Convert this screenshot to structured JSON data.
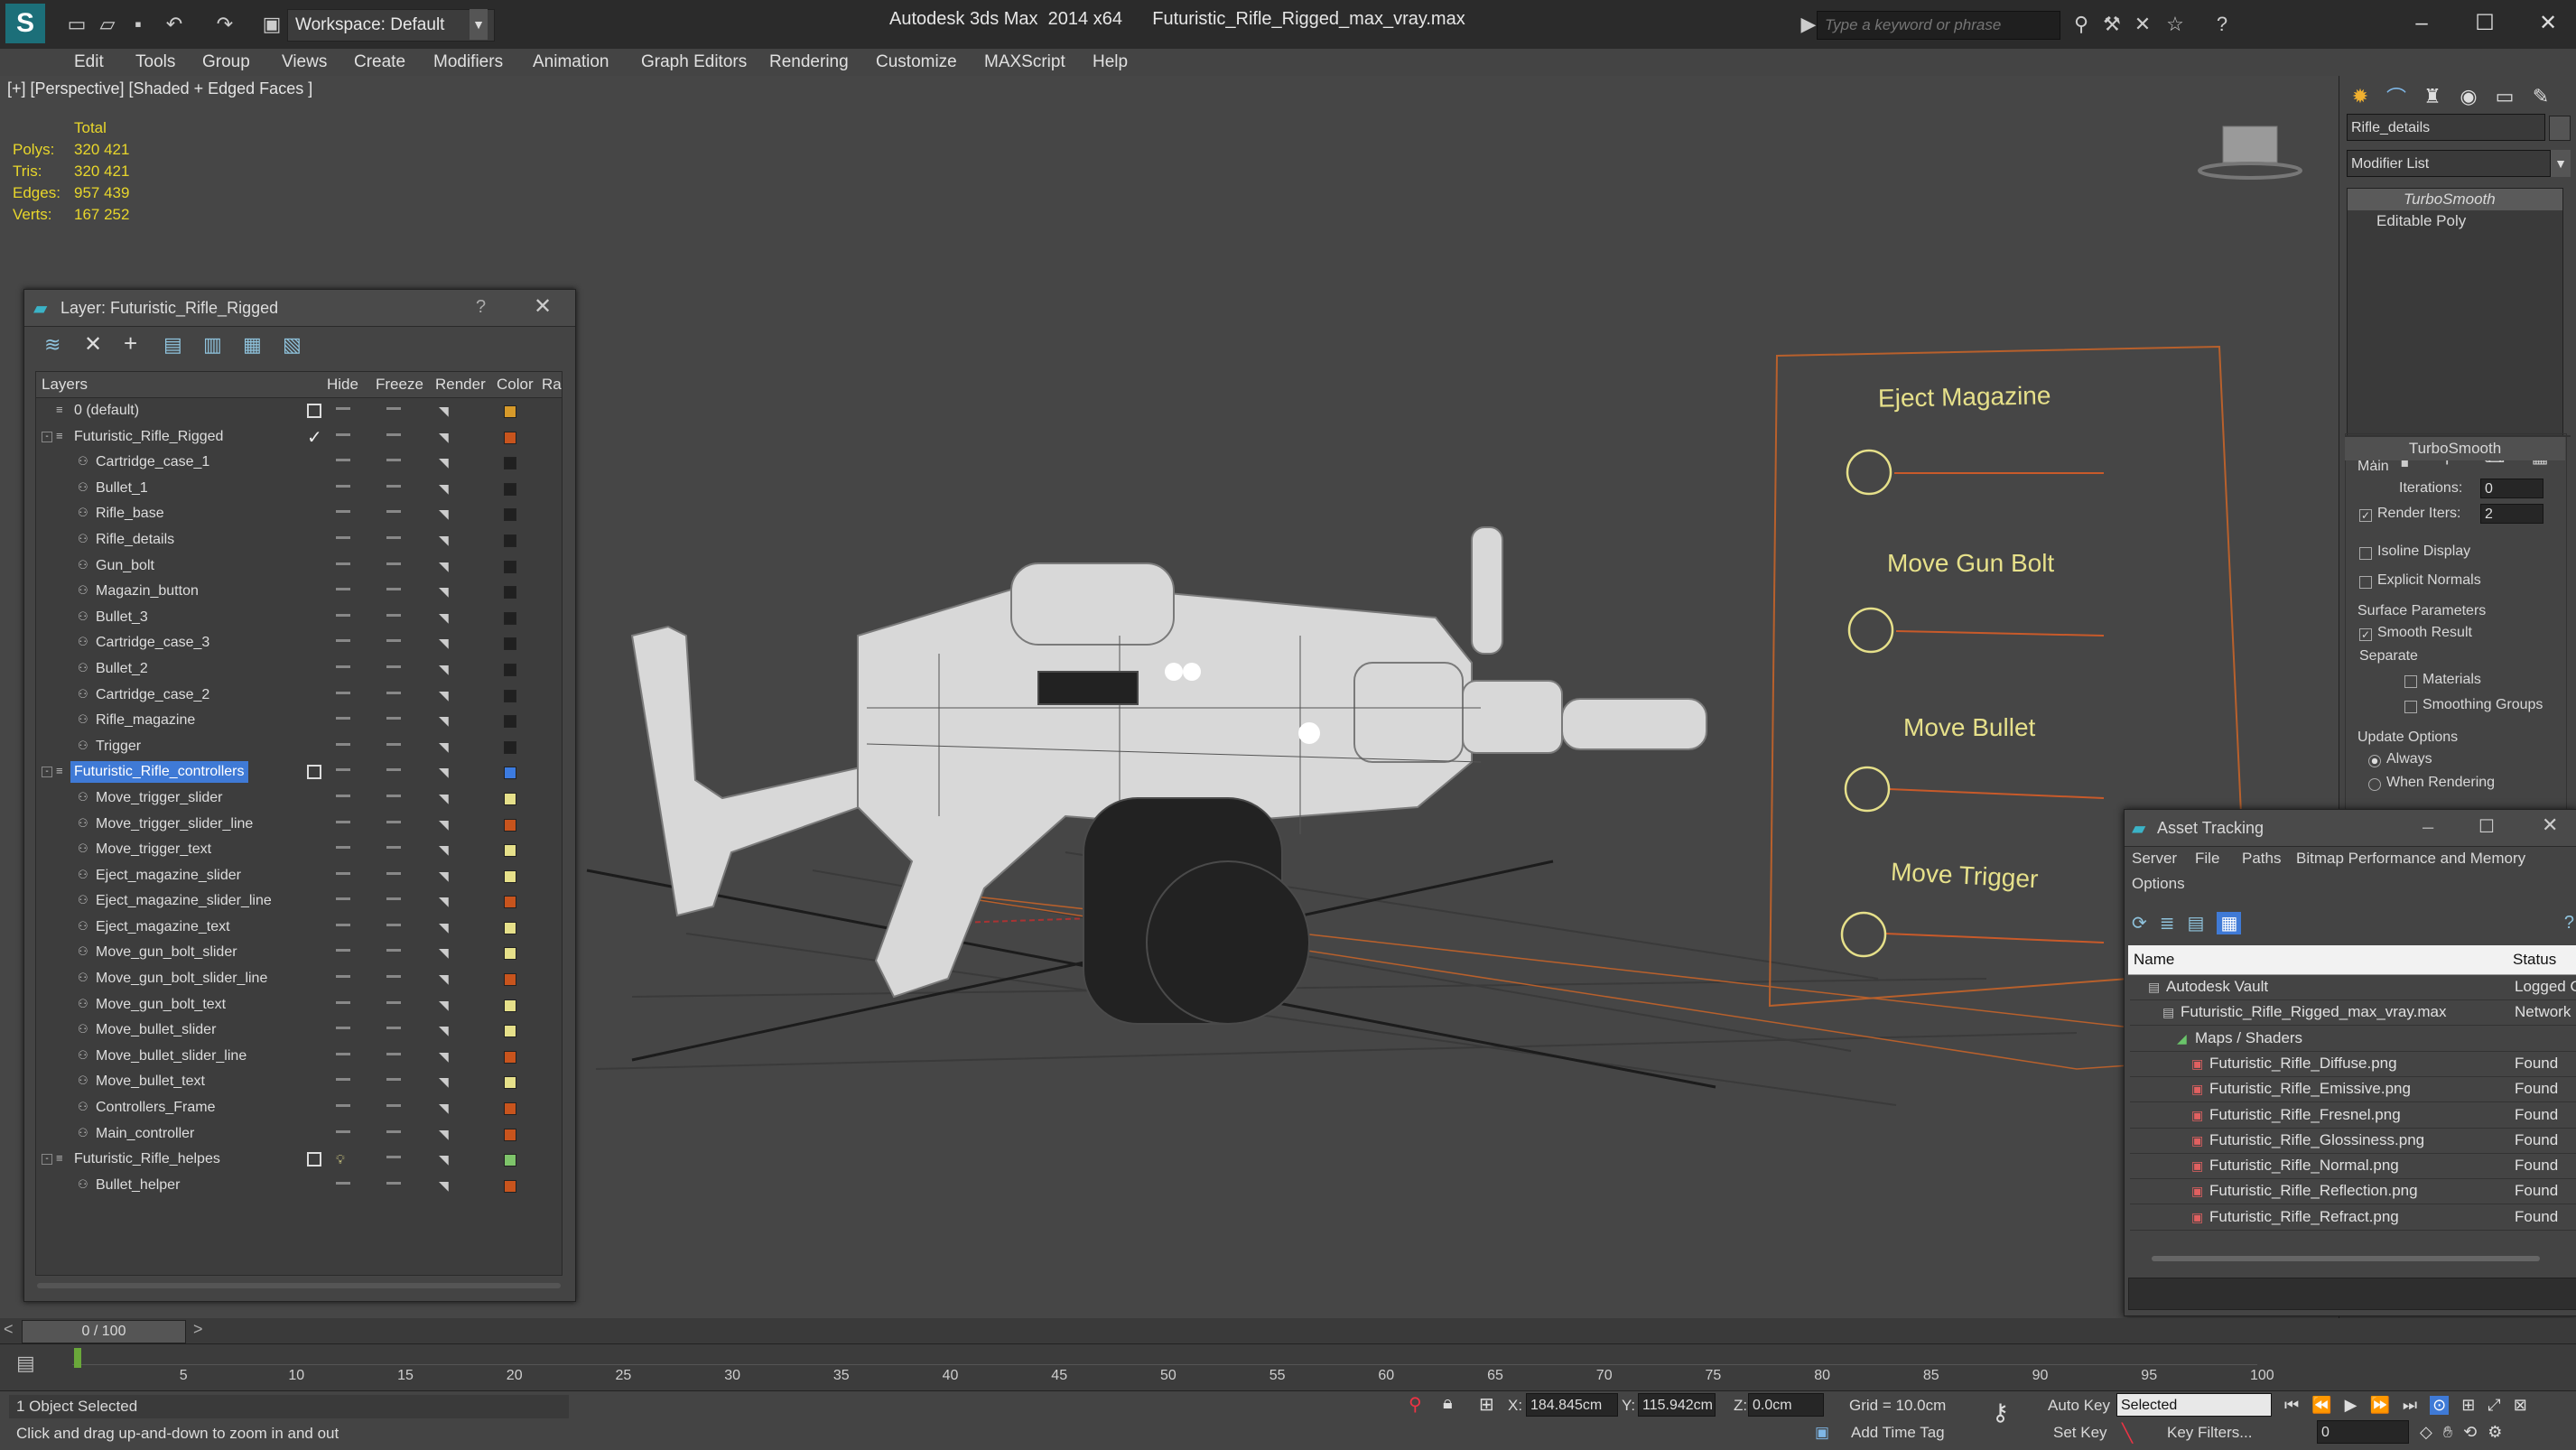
{
  "app": {
    "title": "Autodesk 3ds Max  2014 x64      Futuristic_Rifle_Rigged_max_vray.max",
    "workspace": "Workspace: Default",
    "search_placeholder": "Type a keyword or phrase"
  },
  "menu": [
    "Edit",
    "Tools",
    "Group",
    "Views",
    "Create",
    "Modifiers",
    "Animation",
    "Graph Editors",
    "Rendering",
    "Customize",
    "MAXScript",
    "Help"
  ],
  "viewport": {
    "label": "[+] [Perspective] [Shaded + Edged Faces ]",
    "stats_header": "Total",
    "stats": [
      {
        "label": "Polys:",
        "value": "320 421"
      },
      {
        "label": "Tris:",
        "value": "320 421"
      },
      {
        "label": "Edges:",
        "value": "957 439"
      },
      {
        "label": "Verts:",
        "value": "167 252"
      }
    ],
    "controls_board": [
      "Eject Magazine",
      "Move Gun Bolt",
      "Move Bullet",
      "Move Trigger"
    ]
  },
  "layer_dialog": {
    "title": "Layer: Futuristic_Rifle_Rigged",
    "help": "?",
    "columns": [
      "Layers",
      "Hide",
      "Freeze",
      "Render",
      "Color",
      "Ra"
    ],
    "rows": [
      {
        "name": "0 (default)",
        "level": 0,
        "kind": "layer",
        "color": "#d79a2a",
        "mark": "box"
      },
      {
        "name": "Futuristic_Rifle_Rigged",
        "level": 0,
        "kind": "layer",
        "expand": "-",
        "color": "#c8541d",
        "mark": "tick"
      },
      {
        "name": "Cartridge_case_1",
        "level": 1,
        "kind": "obj",
        "color": "#202020"
      },
      {
        "name": "Bullet_1",
        "level": 1,
        "kind": "obj",
        "color": "#202020"
      },
      {
        "name": "Rifle_base",
        "level": 1,
        "kind": "obj",
        "color": "#202020"
      },
      {
        "name": "Rifle_details",
        "level": 1,
        "kind": "obj",
        "color": "#202020"
      },
      {
        "name": "Gun_bolt",
        "level": 1,
        "kind": "obj",
        "color": "#202020"
      },
      {
        "name": "Magazin_button",
        "level": 1,
        "kind": "obj",
        "color": "#202020"
      },
      {
        "name": "Bullet_3",
        "level": 1,
        "kind": "obj",
        "color": "#202020"
      },
      {
        "name": "Cartridge_case_3",
        "level": 1,
        "kind": "obj",
        "color": "#202020"
      },
      {
        "name": "Bullet_2",
        "level": 1,
        "kind": "obj",
        "color": "#202020"
      },
      {
        "name": "Cartridge_case_2",
        "level": 1,
        "kind": "obj",
        "color": "#202020"
      },
      {
        "name": "Rifle_magazine",
        "level": 1,
        "kind": "obj",
        "color": "#202020"
      },
      {
        "name": "Trigger",
        "level": 1,
        "kind": "obj",
        "color": "#202020"
      },
      {
        "name": "Futuristic_Rifle_controllers",
        "level": 0,
        "kind": "layer",
        "expand": "-",
        "color": "#3c7be0",
        "mark": "box",
        "selected": true
      },
      {
        "name": "Move_trigger_slider",
        "level": 1,
        "kind": "obj",
        "color": "#e6e08a"
      },
      {
        "name": "Move_trigger_slider_line",
        "level": 1,
        "kind": "obj",
        "color": "#c8541d"
      },
      {
        "name": "Move_trigger_text",
        "level": 1,
        "kind": "obj",
        "color": "#e6e08a"
      },
      {
        "name": "Eject_magazine_slider",
        "level": 1,
        "kind": "obj",
        "color": "#e6e08a"
      },
      {
        "name": "Eject_magazine_slider_line",
        "level": 1,
        "kind": "obj",
        "color": "#c8541d"
      },
      {
        "name": "Eject_magazine_text",
        "level": 1,
        "kind": "obj",
        "color": "#e6e08a"
      },
      {
        "name": "Move_gun_bolt_slider",
        "level": 1,
        "kind": "obj",
        "color": "#e6e08a"
      },
      {
        "name": "Move_gun_bolt_slider_line",
        "level": 1,
        "kind": "obj",
        "color": "#c8541d"
      },
      {
        "name": "Move_gun_bolt_text",
        "level": 1,
        "kind": "obj",
        "color": "#e6e08a"
      },
      {
        "name": "Move_bullet_slider",
        "level": 1,
        "kind": "obj",
        "color": "#e6e08a"
      },
      {
        "name": "Move_bullet_slider_line",
        "level": 1,
        "kind": "obj",
        "color": "#c8541d"
      },
      {
        "name": "Move_bullet_text",
        "level": 1,
        "kind": "obj",
        "color": "#e6e08a"
      },
      {
        "name": "Controllers_Frame",
        "level": 1,
        "kind": "obj",
        "color": "#c8541d"
      },
      {
        "name": "Main_controller",
        "level": 1,
        "kind": "obj",
        "color": "#c8541d"
      },
      {
        "name": "Futuristic_Rifle_helpes",
        "level": 0,
        "kind": "layer",
        "expand": "-",
        "color": "#7ec46a",
        "mark": "box",
        "bulb": true
      },
      {
        "name": "Bullet_helper",
        "level": 1,
        "kind": "obj",
        "color": "#c8541d"
      }
    ]
  },
  "command_panel": {
    "object_name": "Rifle_details",
    "modifier_list": "Modifier List",
    "stack": [
      "TurboSmooth",
      "Editable Poly"
    ],
    "rollout_title": "TurboSmooth",
    "main_label": "Main",
    "iterations_label": "Iterations:",
    "iterations_value": "0",
    "render_iters_label": "Render Iters:",
    "render_iters_value": "2",
    "isoline": "Isoline Display",
    "explicit": "Explicit Normals",
    "surface_params": "Surface Parameters",
    "smooth_result": "Smooth Result",
    "separate": "Separate",
    "materials": "Materials",
    "smoothing_groups": "Smoothing Groups",
    "update_options": "Update Options",
    "always": "Always",
    "when_rendering": "When Rendering"
  },
  "asset_tracking": {
    "title": "Asset Tracking",
    "menu": [
      "Server",
      "File",
      "Paths",
      "Bitmap Performance and Memory",
      "Options"
    ],
    "col_name": "Name",
    "col_status": "Status",
    "rows": [
      {
        "name": "Autodesk Vault",
        "status": "Logged O",
        "indent": 1
      },
      {
        "name": "Futuristic_Rifle_Rigged_max_vray.max",
        "status": "Network",
        "indent": 2
      },
      {
        "name": "Maps / Shaders",
        "status": "",
        "indent": 3
      },
      {
        "name": "Futuristic_Rifle_Diffuse.png",
        "status": "Found",
        "indent": 4
      },
      {
        "name": "Futuristic_Rifle_Emissive.png",
        "status": "Found",
        "indent": 4
      },
      {
        "name": "Futuristic_Rifle_Fresnel.png",
        "status": "Found",
        "indent": 4
      },
      {
        "name": "Futuristic_Rifle_Glossiness.png",
        "status": "Found",
        "indent": 4
      },
      {
        "name": "Futuristic_Rifle_Normal.png",
        "status": "Found",
        "indent": 4
      },
      {
        "name": "Futuristic_Rifle_Reflection.png",
        "status": "Found",
        "indent": 4
      },
      {
        "name": "Futuristic_Rifle_Refract.png",
        "status": "Found",
        "indent": 4
      }
    ]
  },
  "timeline": {
    "frame": "0 / 100",
    "ticks": [
      "5",
      "10",
      "15",
      "20",
      "25",
      "30",
      "35",
      "40",
      "45",
      "50",
      "55",
      "60",
      "65",
      "70",
      "75",
      "80",
      "85",
      "90",
      "95",
      "100"
    ]
  },
  "status": {
    "selected": "1 Object Selected",
    "hint": "Click and drag up-and-down to zoom in and out",
    "x_label": "X:",
    "x_value": "184.845cm",
    "y_label": "Y:",
    "y_value": "115.942cm",
    "z_label": "Z:",
    "z_value": "0.0cm",
    "grid": "Grid = 10.0cm",
    "auto_key": "Auto Key",
    "auto_key_mode": "Selected",
    "set_key": "Set Key",
    "key_filters": "Key Filters...",
    "add_time_tag": "Add Time Tag",
    "frame_field": "0"
  }
}
